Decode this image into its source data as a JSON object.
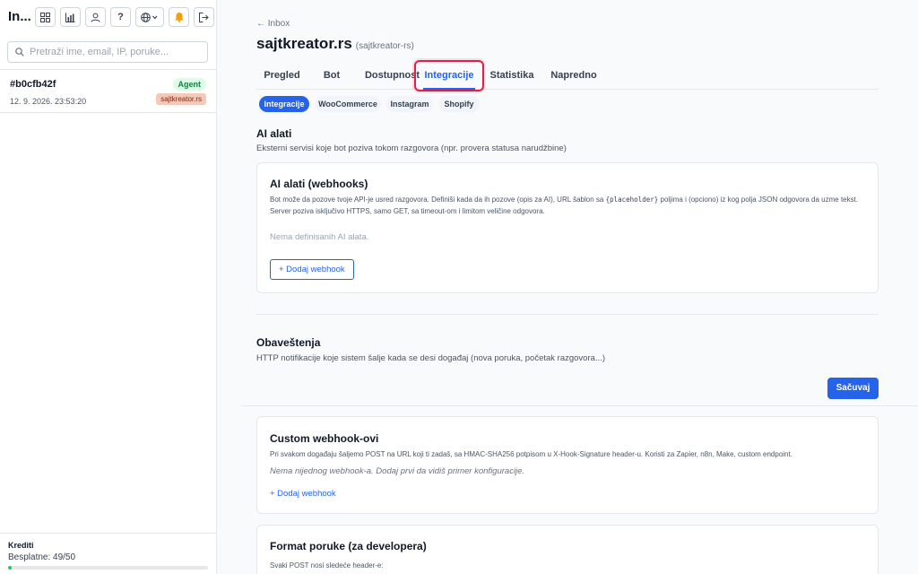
{
  "sidebar": {
    "app_title": "In...",
    "icons": [
      "grid-icon",
      "bar-chart-icon",
      "user-icon",
      "help-icon",
      "globe-icon",
      "bell-icon",
      "logout-icon"
    ],
    "help_label": "?",
    "search": {
      "placeholder": "Pretraži ime, email, IP, poruke...",
      "value": ""
    },
    "conversations": [
      {
        "id": "#b0cfb42f",
        "time": "12. 9. 2026. 23:53:20",
        "status": "Agent",
        "site": "sajtkreator.rs"
      }
    ],
    "credits": {
      "label": "Krediti",
      "value": "Besplatne: 49/50",
      "fraction": 0.02
    }
  },
  "header": {
    "back": "← Inbox",
    "title": "sajtkreator.rs",
    "subtitle": "(sajtkreator-rs)"
  },
  "tabs": [
    "Pregled",
    "Bot",
    "Dostupnost",
    "Integracije",
    "Statistika",
    "Napredno"
  ],
  "active_tab": "Integracije",
  "subtabs": [
    "Integracije",
    "WooCommerce",
    "Instagram",
    "Shopify"
  ],
  "ai_tools": {
    "title": "AI alati",
    "desc": "Eksterni servisi koje bot poziva tokom razgovora (npr. provera statusa narudžbine)",
    "card": {
      "title": "AI alati (webhooks)",
      "desc_a": "Bot može da pozove tvoje API-je usred razgovora. Definiši kada da ih pozove (opis za AI), URL šablon sa ",
      "desc_code": "{placeholder}",
      "desc_b": " poljima i (opciono) iz kog polja JSON odgovora da uzme tekst. Server poziva isključivo HTTPS, samo GET, sa timeout-om i limitom veličine odgovora.",
      "empty": "Nema definisanih AI alata.",
      "add_button": "+ Dodaj webhook"
    }
  },
  "notifications": {
    "title": "Obaveštenja",
    "desc": "HTTP notifikacije koje sistem šalje kada se desi događaj (nova poruka, početak razgovora...)",
    "save_button": "Sačuvaj"
  },
  "custom_webhooks": {
    "title": "Custom webhook-ovi",
    "desc": "Pri svakom događaju šaljemo POST na URL koji ti zadaš, sa HMAC-SHA256 potpisom u X-Hook-Signature header-u. Koristi za Zapier, n8n, Make, custom endpoint.",
    "empty": "Nema nijednog webhook-a. Dodaj prvi da vidiš primer konfiguracije.",
    "add_link": "+ Dodaj webhook"
  },
  "format": {
    "title": "Format poruke (za developera)",
    "desc": "Svaki POST nosi sledeće header-e:"
  },
  "colors": {
    "accent": "#2563eb",
    "highlight": "#e11d48",
    "agent_badge": "#dcfce7",
    "site_badge": "#f3c9b9"
  }
}
